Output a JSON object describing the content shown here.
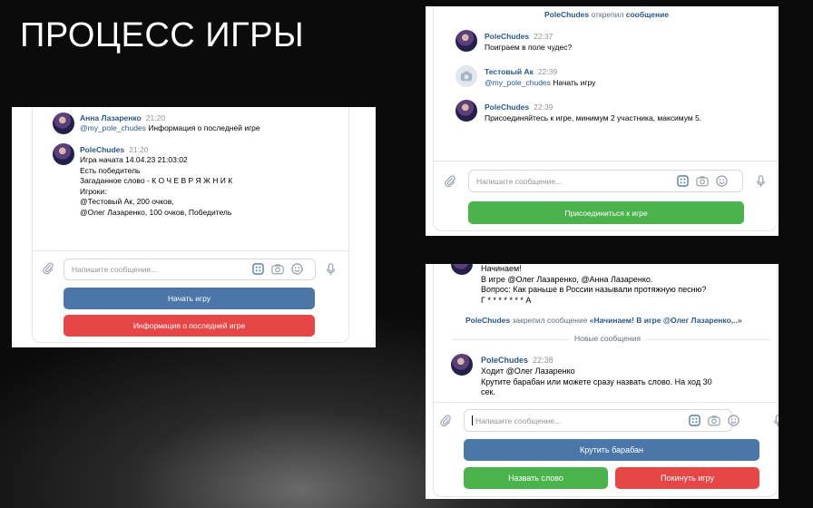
{
  "slide": {
    "title": "ПРОЦЕСС ИГРЫ"
  },
  "common": {
    "input_placeholder": "Напишите сообщение...",
    "mention_bot": "@my_pole_chudes"
  },
  "panel1": {
    "messages": [
      {
        "author": "Анна Лазаренко",
        "time": "21:20",
        "mention": "@my_pole_chudes",
        "text": " Информация о последней игре"
      },
      {
        "author": "PoleChudes",
        "time": "21:20",
        "lines": [
          "Игра начата 14.04.23 21:03:02",
          "Есть победитель",
          "Загаданное слово - К О Ч Е В Р Я Ж Н И К",
          "Игроки:",
          "@Тестовый Ак, 200 очков,",
          "@Олег Лазаренко, 100 очков, Победитель"
        ]
      }
    ],
    "buttons": {
      "start": "Начать игру",
      "info": "Информация о последней игре"
    }
  },
  "panel2": {
    "system": {
      "who": "PoleChudes",
      "action": " открепил ",
      "what": "сообщение"
    },
    "messages": [
      {
        "author": "PoleChudes",
        "time": "22:37",
        "text": "Поиграем в поле чудес?"
      },
      {
        "author": "Тестовый Ак",
        "time": "22:39",
        "mention": "@my_pole_chudes",
        "text": " Начать игру"
      },
      {
        "author": "PoleChudes",
        "time": "22:39",
        "text": "Присоединяйтесь к игре, минимум 2 участника, максимум 5."
      }
    ],
    "buttons": {
      "join": "Присоединиться к игре"
    }
  },
  "panel3": {
    "top_lines": [
      "Начинаем!",
      "В игре @Олег Лазаренко, @Анна Лазаренко.",
      "Вопрос: Как раньше в России называли протяжную песню?",
      "Г * * * * * * * А"
    ],
    "system": {
      "who": "PoleChudes",
      "action": " закрепил сообщение ",
      "what": "«Начинаем! В игре @Олег Лазаренко,..»"
    },
    "new_messages": "Новые сообщения",
    "message": {
      "author": "PoleChudes",
      "time": "22:38",
      "lines": [
        "Ходит @Олег Лазаренко",
        "Крутите барабан или можете сразу назвать слово. На ход 30",
        "сек."
      ]
    },
    "buttons": {
      "spin": "Крутить барабан",
      "guess": "Назвать слово",
      "leave": "Покинуть игру"
    }
  },
  "colors": {
    "link": "#2a5885",
    "blue_button": "#4a76a8",
    "red_button": "#e64646",
    "green_button": "#4bb34b",
    "slide_background": "#0b0b0b"
  },
  "icons": [
    "paperclip-icon",
    "keyboard-icon",
    "camera-icon",
    "smile-icon",
    "microphone-icon"
  ]
}
